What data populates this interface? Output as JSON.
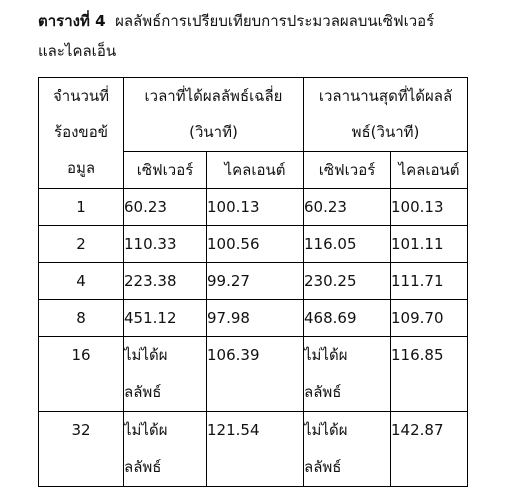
{
  "caption": {
    "label": "ตารางที่ 4",
    "line1": "ผลลัพธ์การเปรียบเทียบการประมวลผลบนเซิฟเวอร์",
    "line2": "และไคลเอ็น"
  },
  "table": {
    "header": {
      "col0": "จำนวนที่ร้องขอข้อมูล",
      "group1": "เวลาที่ได้ผลลัพธ์เฉลี่ย (วินาที)",
      "group2": "เวลานานสุดที่ได้ผลลัพธ์(วินาที)",
      "sub_server_1": "เซิฟเวอร์",
      "sub_client_1": "ไคลเอนต์",
      "sub_server_2": "เซิฟเวอร์",
      "sub_client_2": "ไคลเอนต์"
    },
    "rows": [
      {
        "requests": "1",
        "avg_server": "60.23",
        "avg_client": "100.13",
        "max_server": "60.23",
        "max_client": "100.13"
      },
      {
        "requests": "2",
        "avg_server": "110.33",
        "avg_client": "100.56",
        "max_server": "116.05",
        "max_client": "101.11"
      },
      {
        "requests": "4",
        "avg_server": "223.38",
        "avg_client": "99.27",
        "max_server": "230.25",
        "max_client": "111.71"
      },
      {
        "requests": "8",
        "avg_server": "451.12",
        "avg_client": "97.98",
        "max_server": "468.69",
        "max_client": "109.70"
      },
      {
        "requests": "16",
        "avg_server": "ไม่ได้ผลลัพธ์",
        "avg_client": "106.39",
        "max_server": "ไม่ได้ผลลัพธ์",
        "max_client": "116.85"
      },
      {
        "requests": "32",
        "avg_server": "ไม่ได้ผลลัพธ์",
        "avg_client": "121.54",
        "max_server": "ไม่ได้ผลลัพธ์",
        "max_client": "142.87"
      }
    ]
  }
}
